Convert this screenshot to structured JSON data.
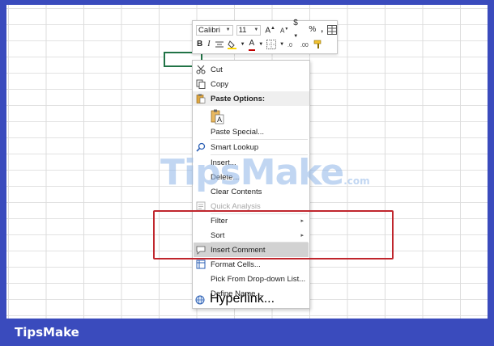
{
  "mini_toolbar": {
    "font_name": "Calibri",
    "font_size": "11",
    "grow_font": "A",
    "shrink_font": "A",
    "currency": "$",
    "percent": "%",
    "comma": ",",
    "bold": "B",
    "italic": "I",
    "font_color": "A"
  },
  "menu": {
    "cut": "Cut",
    "copy": "Copy",
    "paste_options": "Paste Options:",
    "paste_icon_letter": "A",
    "paste_special": "Paste Special...",
    "smart_lookup": "Smart Lookup",
    "insert": "Insert...",
    "delete": "Delete...",
    "clear_contents": "Clear Contents",
    "quick_analysis": "Quick Analysis",
    "filter": "Filter",
    "sort": "Sort",
    "insert_comment": "Insert Comment",
    "format_cells": "Format Cells...",
    "pick_from_list": "Pick From Drop-down List...",
    "define_name": "Define Name...",
    "hyperlink": "Hyperlink...",
    "submenu_arrow": "▸"
  },
  "watermark": {
    "main": "TipsMake",
    "suffix": ".com"
  },
  "brand": "TipsMake",
  "colors": {
    "accent_green": "#217346",
    "highlight_red": "#c0262d",
    "font_color_bar": "#c00000",
    "fill_color_bar": "#ffd700"
  }
}
